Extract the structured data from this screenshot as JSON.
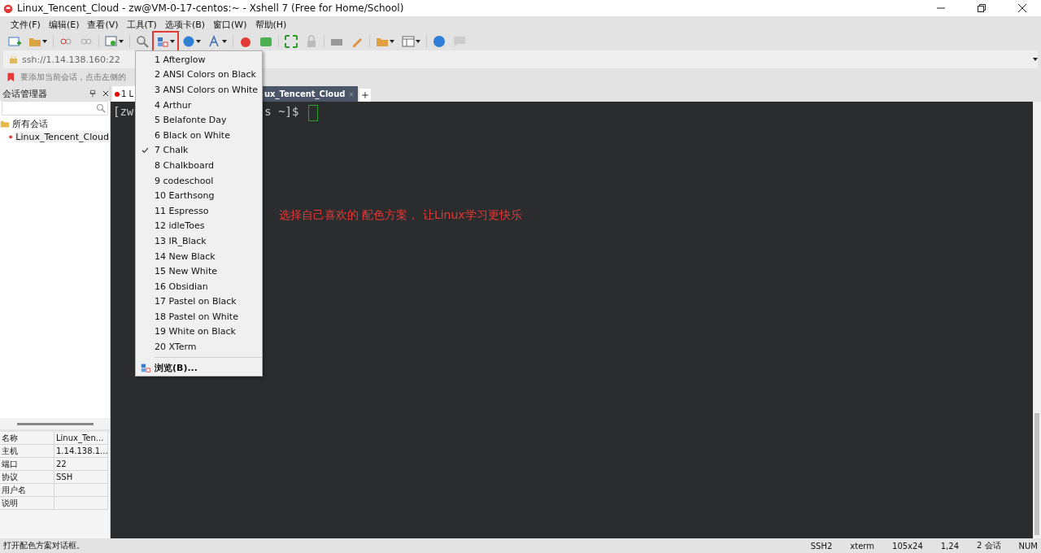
{
  "window": {
    "title": "Linux_Tencent_Cloud - zw@VM-0-17-centos:~ - Xshell 7 (Free for Home/School)"
  },
  "menu_bar": [
    "文件(F)",
    "编辑(E)",
    "查看(V)",
    "工具(T)",
    "选项卡(B)",
    "窗口(W)",
    "帮助(H)"
  ],
  "address_bar": {
    "value": "ssh://1.14.138.160:22"
  },
  "info_bar": {
    "text": "要添加当前会话，点击左侧的"
  },
  "session_manager": {
    "title": "会话管理器",
    "tree": [
      {
        "label": "所有会话",
        "children": [
          {
            "label": "Linux_Tencent_Cloud",
            "selected": true
          }
        ]
      }
    ],
    "properties": [
      {
        "key": "名称",
        "value": "Linux_Ten..."
      },
      {
        "key": "主机",
        "value": "1.14.138.1..."
      },
      {
        "key": "端口",
        "value": "22"
      },
      {
        "key": "协议",
        "value": "SSH"
      },
      {
        "key": "用户名"
      },
      {
        "key": "说明"
      }
    ]
  },
  "tabs": [
    {
      "label": "1 L",
      "selected": false
    },
    {
      "label": "ux_Tencent_Cloud",
      "selected": true
    }
  ],
  "terminal": {
    "prompt_start": "[zw",
    "prompt_end": "s ~]$"
  },
  "annotation": "选择自己喜欢的 配色方案， 让Linux学习更快乐",
  "color_scheme_menu": {
    "items": [
      {
        "label": "1 Afterglow",
        "checked": false
      },
      {
        "label": "2 ANSI Colors on Black",
        "checked": false
      },
      {
        "label": "3 ANSI Colors on White",
        "checked": false
      },
      {
        "label": "4 Arthur",
        "checked": false
      },
      {
        "label": "5 Belafonte Day",
        "checked": false
      },
      {
        "label": "6 Black on White",
        "checked": false
      },
      {
        "label": "7 Chalk",
        "checked": true
      },
      {
        "label": "8 Chalkboard",
        "checked": false
      },
      {
        "label": "9 codeschool",
        "checked": false
      },
      {
        "label": "10 Earthsong",
        "checked": false
      },
      {
        "label": "11 Espresso",
        "checked": false
      },
      {
        "label": "12 idleToes",
        "checked": false
      },
      {
        "label": "13 IR_Black",
        "checked": false
      },
      {
        "label": "14 New Black",
        "checked": false
      },
      {
        "label": "15 New White",
        "checked": false
      },
      {
        "label": "16 Obsidian",
        "checked": false
      },
      {
        "label": "17 Pastel on Black",
        "checked": false
      },
      {
        "label": "18 Pastel on White",
        "checked": false
      },
      {
        "label": "19 White on Black",
        "checked": false
      },
      {
        "label": "20 XTerm",
        "checked": false
      }
    ],
    "browse": "浏览(B)..."
  },
  "status_bar": {
    "message": "打开配色方案对话框。",
    "fields": [
      "SSH2",
      "xterm",
      "105x24",
      "1,24",
      "2 会话",
      "NUM"
    ]
  }
}
